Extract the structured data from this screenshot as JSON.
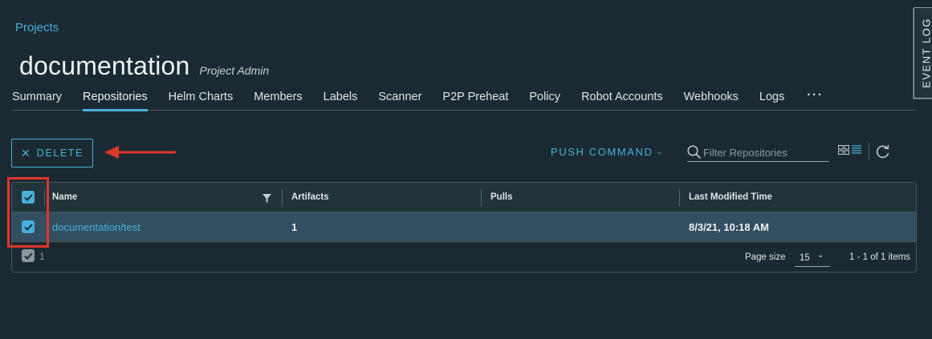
{
  "breadcrumb": {
    "label": "Projects"
  },
  "project": {
    "name": "documentation",
    "role": "Project Admin"
  },
  "tabs": [
    {
      "label": "Summary"
    },
    {
      "label": "Repositories",
      "active": true
    },
    {
      "label": "Helm Charts"
    },
    {
      "label": "Members"
    },
    {
      "label": "Labels"
    },
    {
      "label": "Scanner"
    },
    {
      "label": "P2P Preheat"
    },
    {
      "label": "Policy"
    },
    {
      "label": "Robot Accounts"
    },
    {
      "label": "Webhooks"
    },
    {
      "label": "Logs"
    },
    {
      "label": "···"
    }
  ],
  "event_log": {
    "label": "EVENT LOG"
  },
  "toolbar": {
    "delete_label": "DELETE",
    "push_command_label": "PUSH COMMAND",
    "filter_placeholder": "Filter Repositories"
  },
  "table": {
    "columns": [
      "Name",
      "Artifacts",
      "Pulls",
      "Last Modified Time"
    ],
    "rows": [
      {
        "name": "documentation/test",
        "artifacts": "1",
        "pulls": "",
        "last_modified": "8/3/21, 10:18 AM",
        "selected": true
      }
    ],
    "selected_count": "1",
    "page_size_label": "Page size",
    "page_size_value": "15",
    "items_summary": "1 - 1 of 1 items"
  },
  "colors": {
    "accent": "#49afd9",
    "annotation": "#e0362b",
    "background": "#1b2a32",
    "selected_row": "#324f61"
  }
}
